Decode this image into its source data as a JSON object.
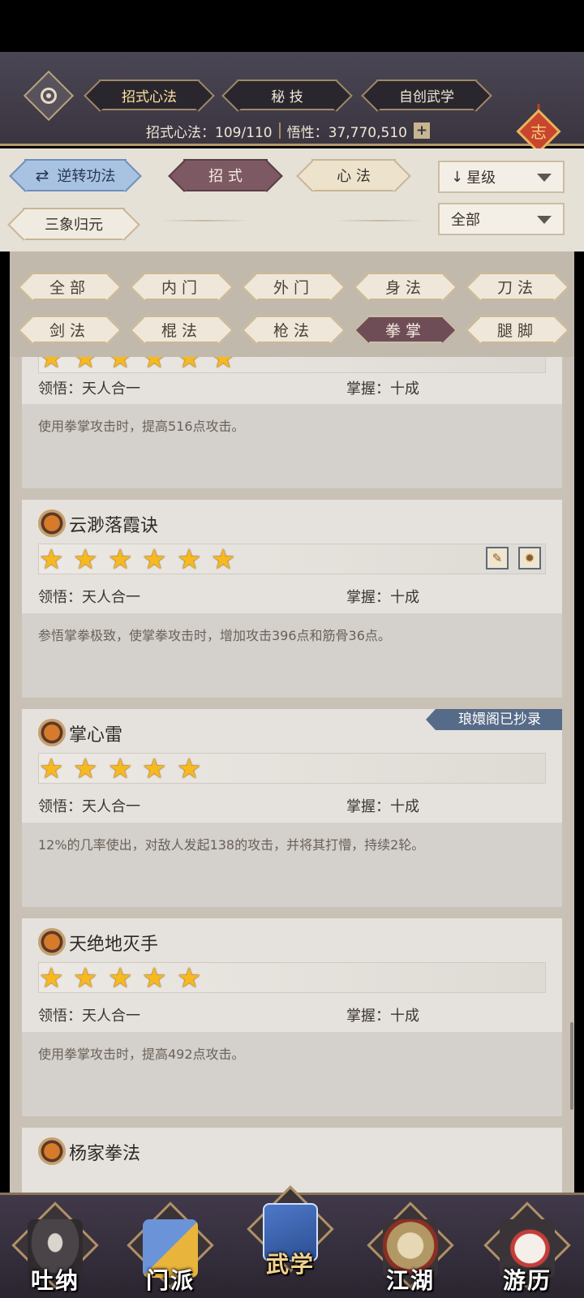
{
  "header": {
    "tabs": [
      {
        "label": "招式心法",
        "active": true
      },
      {
        "label": "秘 技",
        "active": false
      },
      {
        "label": "自创武学",
        "active": false
      }
    ],
    "stats": {
      "moves_label": "招式心法：109/110",
      "insight_label": "悟性：37,770,510"
    },
    "ornament_char": "志"
  },
  "filters": {
    "reverse_button": "逆转功法",
    "type_tabs": [
      {
        "label": "招 式",
        "active": true
      },
      {
        "label": "心 法",
        "active": false
      }
    ],
    "sanxiang_button": "三象归元",
    "sort_dropdown": "星级",
    "sort_arrow": "↓",
    "range_dropdown": "全部"
  },
  "categories": [
    {
      "label": "全部",
      "active": false
    },
    {
      "label": "内门",
      "active": false
    },
    {
      "label": "外门",
      "active": false
    },
    {
      "label": "身法",
      "active": false
    },
    {
      "label": "刀法",
      "active": false
    },
    {
      "label": "剑法",
      "active": false
    },
    {
      "label": "棍法",
      "active": false
    },
    {
      "label": "枪法",
      "active": false
    },
    {
      "label": "拳掌",
      "active": true
    },
    {
      "label": "腿脚",
      "active": false
    }
  ],
  "skills": [
    {
      "name": "",
      "stars": 6,
      "comprehension": "领悟：天人合一",
      "mastery": "掌握：十成",
      "description": "使用拳掌攻击时，提高516点攻击。"
    },
    {
      "name": "云渺落霞诀",
      "stars": 6,
      "comprehension": "领悟：天人合一",
      "mastery": "掌握：十成",
      "description": "参悟掌拳极致，使掌拳攻击时，增加攻击396点和筋骨36点。",
      "mini_icons": [
        "scroll-icon",
        "dragon-icon"
      ]
    },
    {
      "name": "掌心雷",
      "stars": 5,
      "comprehension": "领悟：天人合一",
      "mastery": "掌握：十成",
      "description": "12%的几率使出，对敌人发起138的攻击，并将其打懵，持续2轮。",
      "tag": "琅嬛阁已抄录"
    },
    {
      "name": "天绝地灭手",
      "stars": 5,
      "comprehension": "领悟：天人合一",
      "mastery": "掌握：十成",
      "description": "使用拳掌攻击时，提高492点攻击。"
    },
    {
      "name": "杨家拳法"
    }
  ],
  "bottom_nav": [
    {
      "label": "吐纳",
      "active": false
    },
    {
      "label": "门派",
      "active": false
    },
    {
      "label": "武学",
      "active": true
    },
    {
      "label": "江湖",
      "active": false
    },
    {
      "label": "游历",
      "active": false
    }
  ],
  "colors": {
    "header_bg": "#433e4a",
    "accent_gold": "#b59a6b",
    "active_category": "#6f4d57",
    "star": "#f6b920",
    "tag_bg": "#566b87"
  }
}
